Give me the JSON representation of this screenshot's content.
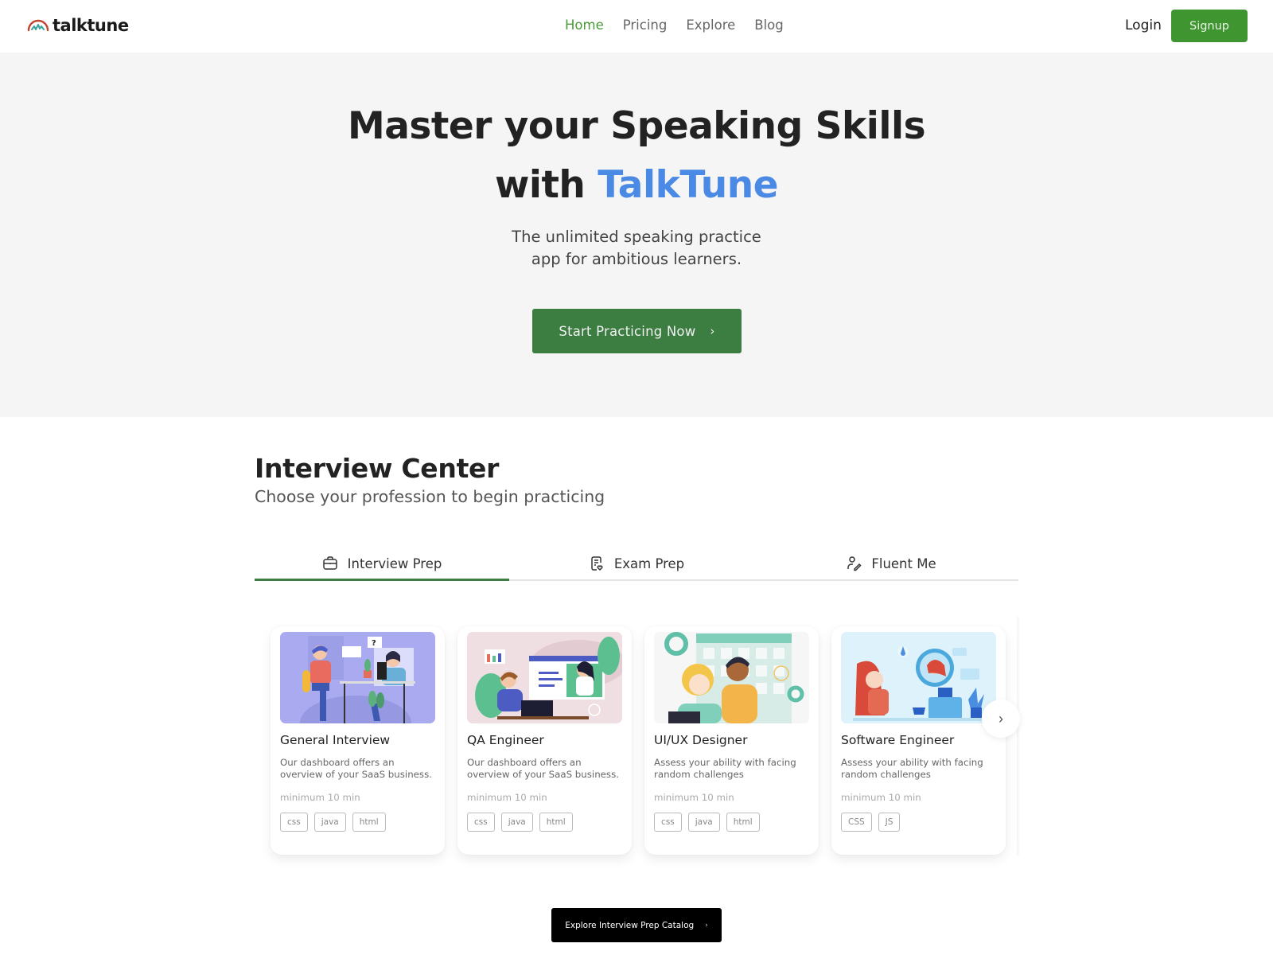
{
  "brand": {
    "name": "talktune"
  },
  "nav": {
    "links": [
      {
        "label": "Home",
        "active": true
      },
      {
        "label": "Pricing",
        "active": false
      },
      {
        "label": "Explore",
        "active": false
      },
      {
        "label": "Blog",
        "active": false
      }
    ],
    "login_label": "Login",
    "signup_label": "Signup"
  },
  "hero": {
    "title_line1": "Master your Speaking Skills",
    "title_line2_prefix": "with",
    "title_line2_accent": "TalkTune",
    "subtitle_line1": "The unlimited speaking practice",
    "subtitle_line2": "app for ambitious learners.",
    "cta_label": "Start Practicing Now",
    "cta_icon": "chevron-right-icon"
  },
  "section": {
    "title": "Interview Center",
    "subtitle": "Choose your profession to begin practicing"
  },
  "tabs": [
    {
      "label": "Interview Prep",
      "icon": "briefcase-icon",
      "active": true
    },
    {
      "label": "Exam Prep",
      "icon": "exam-document-icon",
      "active": false
    },
    {
      "label": "Fluent Me",
      "icon": "user-pen-icon",
      "active": false
    }
  ],
  "cards": [
    {
      "title": "General Interview",
      "description": "Our dashboard offers an overview of your SaaS business.",
      "duration": "minimum 10 min",
      "tags": [
        "css",
        "java",
        "html"
      ],
      "image": "interview-illustration"
    },
    {
      "title": "QA Engineer",
      "description": "Our dashboard offers an overview of your SaaS business.",
      "duration": "minimum 10 min",
      "tags": [
        "css",
        "java",
        "html"
      ],
      "image": "video-call-illustration"
    },
    {
      "title": "UI/UX Designer",
      "description": "Assess your ability with facing random challenges",
      "duration": "minimum 10 min",
      "tags": [
        "css",
        "java",
        "html"
      ],
      "image": "calendar-meeting-illustration"
    },
    {
      "title": "Software Engineer",
      "description": "Assess your ability with facing random challenges",
      "duration": "minimum 10 min",
      "tags": [
        "CSS",
        "JS"
      ],
      "image": "remote-support-illustration"
    }
  ],
  "carousel": {
    "next_icon": "chevron-right-icon"
  },
  "explore_label": "Explore Interview Prep Catalog",
  "colors": {
    "brand_green": "#3f9530",
    "cta_green": "#3c7d41",
    "accent_blue": "#4a8ae5",
    "hero_bg": "#f5f5f5"
  }
}
